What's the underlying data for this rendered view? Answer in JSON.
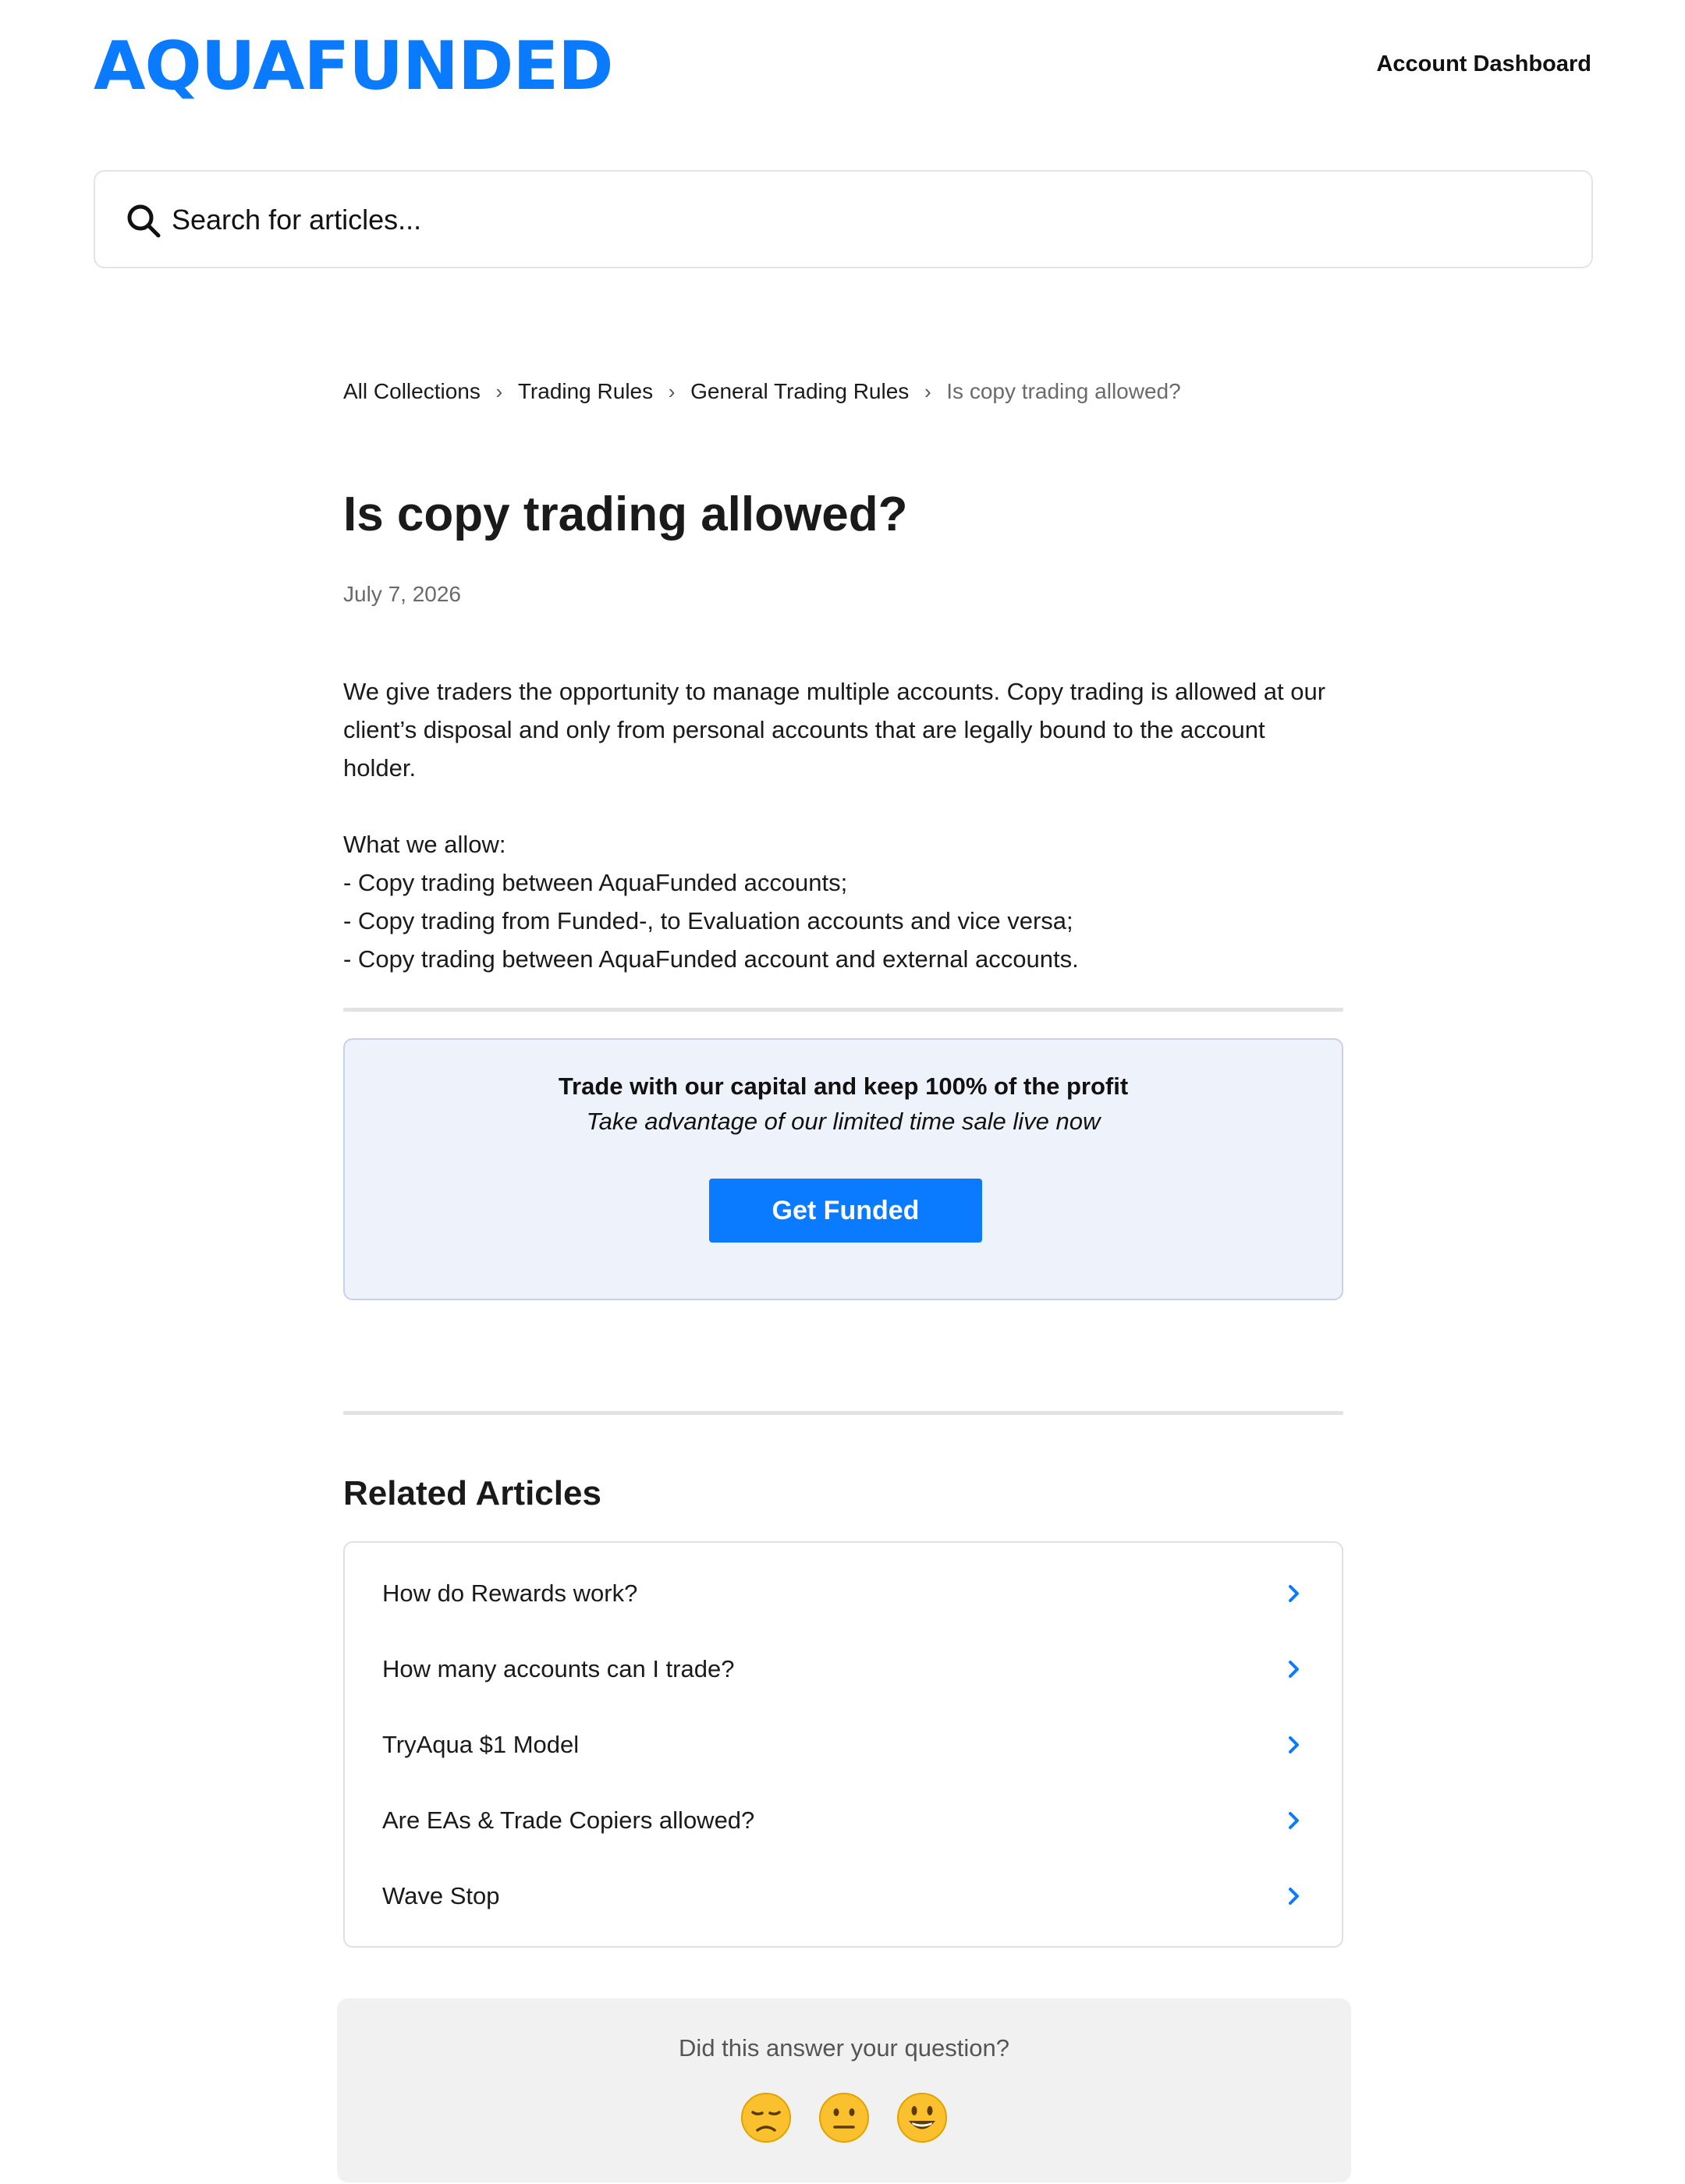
{
  "header": {
    "logo_text": "AQUAFUNDED",
    "dashboard_link": "Account Dashboard",
    "brand_color": "#0a7bff"
  },
  "search": {
    "placeholder": "Search for articles...",
    "icon": "search-icon"
  },
  "breadcrumb": {
    "items": [
      "All Collections",
      "Trading Rules",
      "General Trading Rules"
    ],
    "current": "Is copy trading allowed?",
    "separator": "›"
  },
  "article": {
    "title": "Is copy trading allowed?",
    "date": "July 7, 2026",
    "paragraph": "We give traders the opportunity to manage multiple accounts. Copy trading is allowed at our client’s disposal and only from personal accounts that are legally bound to the account holder.",
    "allow_heading": "What we allow:",
    "allow_items": [
      "- Copy trading between AquaFunded accounts;",
      "- Copy trading from Funded-, to Evaluation accounts and vice versa;",
      "- Copy trading between AquaFunded account and external accounts."
    ]
  },
  "promo": {
    "title": "Trade with our capital and keep 100% of the profit",
    "subtitle": "Take advantage of our limited time sale live now",
    "button": "Get Funded",
    "background": "#eef2fb"
  },
  "related": {
    "title": "Related Articles",
    "items": [
      "How do Rewards work?",
      "How many accounts can I trade?",
      "TryAqua $1 Model",
      "Are EAs & Trade Copiers allowed?",
      "Wave Stop"
    ],
    "chevron_color": "#0a7bff"
  },
  "feedback": {
    "question": "Did this answer your question?",
    "faces": [
      "disappointed-face-icon",
      "neutral-face-icon",
      "smiley-face-icon"
    ]
  }
}
